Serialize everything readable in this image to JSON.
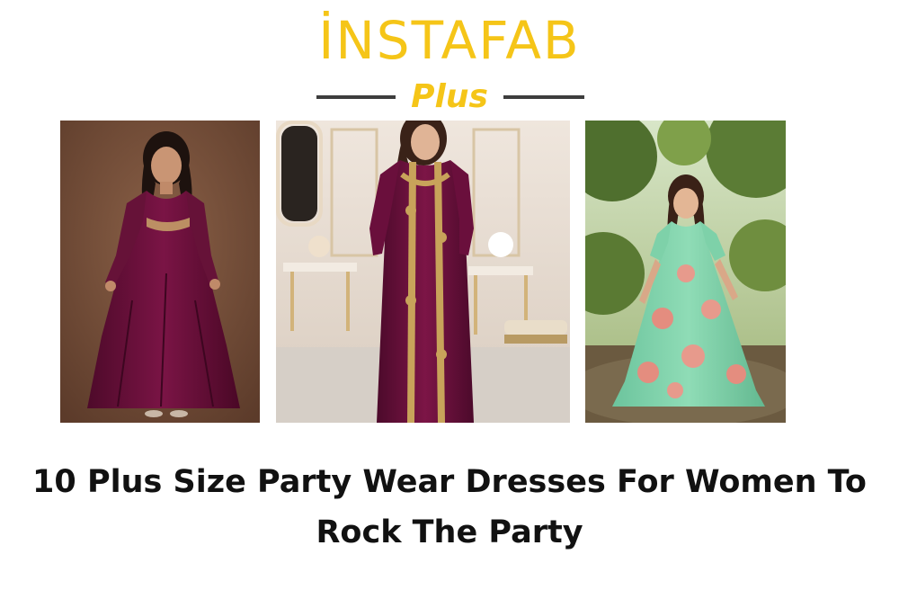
{
  "logo": {
    "wordmark": "İNSTAFAB",
    "sub": "Plus",
    "color": "#f5c518",
    "line_color": "#3d3d3d"
  },
  "photos": [
    {
      "name": "woman-wine-anarkali-gown",
      "dress_color": "#6b0f3a",
      "background_color": "#6e4a36"
    },
    {
      "name": "woman-wine-embroidered-suit",
      "dress_color": "#6a0f3c",
      "background_color": "#e8ddd3"
    },
    {
      "name": "woman-mint-floral-gown",
      "dress_color": "#7fd3ac",
      "background_color": "#5e7a3c"
    }
  ],
  "headline": {
    "line1": "10 Plus Size Party Wear Dresses For Women To",
    "line2": "Rock The Party"
  }
}
